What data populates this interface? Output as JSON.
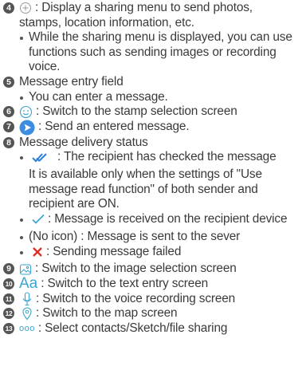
{
  "items": [
    {
      "num": "4",
      "icon": "plus-circle-icon",
      "text": ": Display a sharing menu to send photos,",
      "cont": "stamps, location information, etc."
    },
    {
      "bullet": "While the sharing menu is displayed, you can use",
      "bullet_cont": "functions such as sending images or recording",
      "bullet_cont2": "voice."
    },
    {
      "num": "5",
      "text": "Message entry field"
    },
    {
      "bullet": "You can enter a message."
    },
    {
      "num": "6",
      "icon": "smiley-icon",
      "text": ": Switch to the stamp selection screen"
    },
    {
      "num": "7",
      "icon": "send-arrow-icon",
      "text": ": Send an entered message."
    },
    {
      "num": "8",
      "text": "Message delivery status"
    },
    {
      "icon": "double-check-icon",
      "text": ": The recipient has checked the message",
      "cont": "It is available only when the settings of \"Use",
      "cont2": "message read function\" of both sender and",
      "cont3": "recipient are ON."
    },
    {
      "icon": "check-icon",
      "text": ": Message is received on the recipient device"
    },
    {
      "bullet": "(No icon) : Message is sent to the sever"
    },
    {
      "icon": "cross-icon",
      "text": ": Sending message failed"
    },
    {
      "num": "9",
      "icon": "image-icon",
      "text": ": Switch to the image selection screen"
    },
    {
      "num": "10",
      "icon_text": "Aa",
      "text": ": Switch to the text entry screen"
    },
    {
      "num": "11",
      "icon": "microphone-icon",
      "text": ": Switch to the voice recording screen"
    },
    {
      "num": "12",
      "icon": "map-pin-icon",
      "text": ": Switch to the map screen"
    },
    {
      "num": "13",
      "icon_text": "ooo",
      "text": ": Select contacts/Sketch/file sharing"
    }
  ],
  "colors": {
    "accent": "#3aa6cf",
    "accent_dark": "#2f7ed8",
    "icon_gray": "#9a9a9a",
    "error": "#e0302a",
    "text": "#3a3a3a"
  }
}
